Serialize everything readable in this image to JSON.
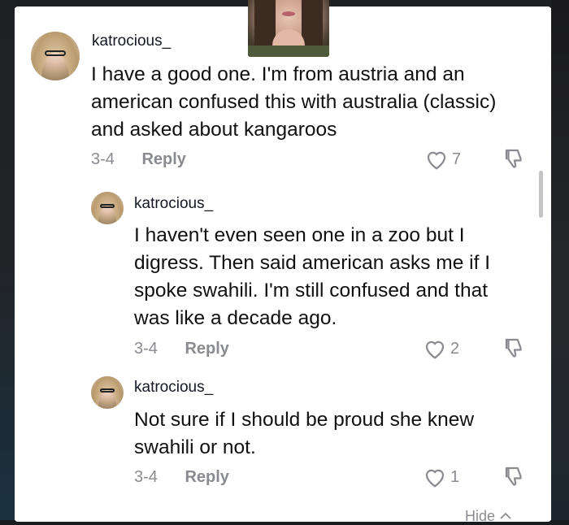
{
  "comments": [
    {
      "username": "katrocious_",
      "text": "I have a good one. I'm from austria and an american confused this with australia (classic) and asked about kangaroos",
      "date": "3-4",
      "reply_label": "Reply",
      "likes": "7"
    },
    {
      "username": "katrocious_",
      "text": "I haven't even seen one in a zoo but I digress. Then said american asks me if I spoke swahili. I'm still confused and that was like a decade ago.",
      "date": "3-4",
      "reply_label": "Reply",
      "likes": "2"
    },
    {
      "username": "katrocious_",
      "text": "Not sure if I should be proud she knew swahili or not.",
      "date": "3-4",
      "reply_label": "Reply",
      "likes": "1"
    }
  ],
  "hide_label": "Hide",
  "icons": {
    "like": "heart-outline-icon",
    "dislike": "thumbs-down-icon",
    "hide": "chevron-up-icon"
  },
  "colors": {
    "meta": "#8a8b91",
    "text": "#111111",
    "background": "#ffffff"
  }
}
